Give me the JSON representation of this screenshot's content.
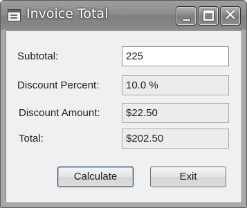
{
  "window": {
    "title": "Invoice Total"
  },
  "title_controls": {
    "minimize_icon": "minimize-icon",
    "maximize_icon": "maximize-icon",
    "close_glyph": "✕"
  },
  "form": {
    "subtotal": {
      "label": "Subtotal:",
      "value": "225"
    },
    "discount_percent": {
      "label": "Discount Percent:",
      "value": "10.0 %"
    },
    "discount_amount": {
      "label": "Discount Amount:",
      "value": "$22.50"
    },
    "total": {
      "label": "Total:",
      "value": "$202.50"
    }
  },
  "buttons": {
    "calculate": "Calculate",
    "exit": "Exit"
  }
}
